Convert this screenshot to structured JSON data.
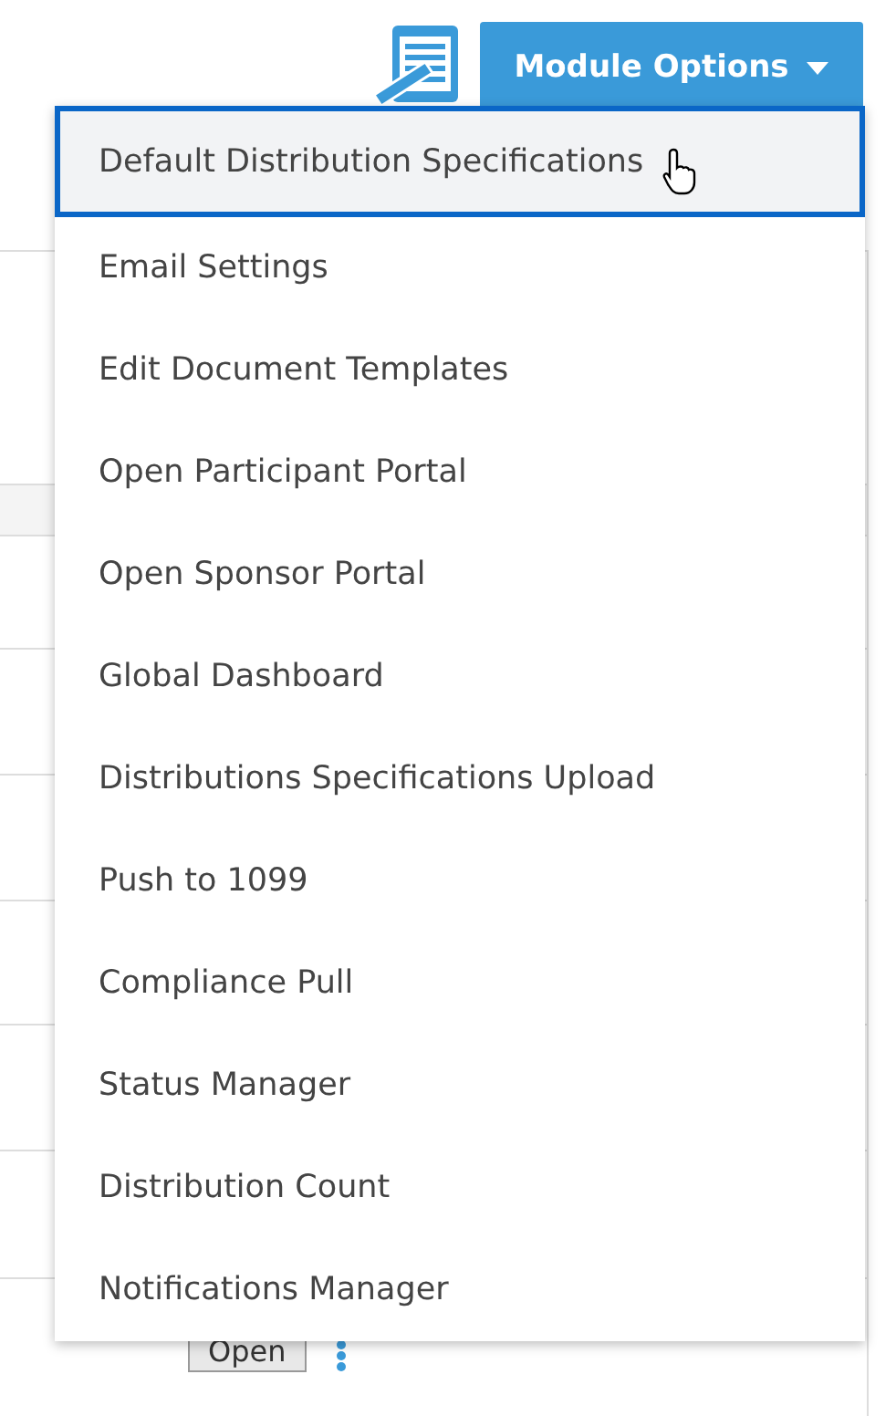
{
  "toolbar": {
    "module_button": {
      "label": "Module Options",
      "expanded": true
    }
  },
  "menu": {
    "items": [
      {
        "label": "Default Distribution Specifications",
        "selected": true
      },
      {
        "label": "Email Settings",
        "selected": false
      },
      {
        "label": "Edit Document Templates",
        "selected": false
      },
      {
        "label": "Open Participant Portal",
        "selected": false
      },
      {
        "label": "Open Sponsor Portal",
        "selected": false
      },
      {
        "label": "Global Dashboard",
        "selected": false
      },
      {
        "label": "Distributions Specifications Upload",
        "selected": false
      },
      {
        "label": "Push to 1099",
        "selected": false
      },
      {
        "label": "Compliance Pull",
        "selected": false
      },
      {
        "label": "Status Manager",
        "selected": false
      },
      {
        "label": "Distribution Count",
        "selected": false
      },
      {
        "label": "Notifications Manager",
        "selected": false
      }
    ]
  },
  "table": {
    "last_row": {
      "button": "Open"
    }
  }
}
